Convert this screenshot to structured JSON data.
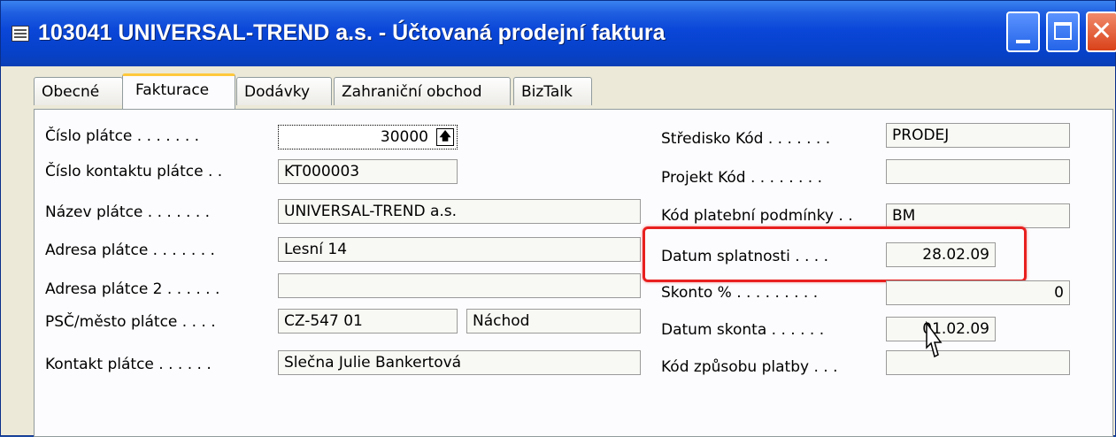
{
  "window": {
    "title": "103041 UNIVERSAL-TREND a.s. - Účtovaná prodejní faktura",
    "minimize_icon": "minimize-icon",
    "maximize_icon": "maximize-icon",
    "close_icon": "close-icon"
  },
  "tabs": [
    {
      "label": "Obecné",
      "active": false
    },
    {
      "label": "Fakturace",
      "active": true
    },
    {
      "label": "Dodávky",
      "active": false
    },
    {
      "label": "Zahraniční obchod",
      "active": false
    },
    {
      "label": "BizTalk",
      "active": false
    }
  ],
  "left_fields": {
    "cislo_platce": {
      "label": "Číslo plátce . . . . . . .",
      "value": "30000",
      "lookup_icon": "arrow-up-icon"
    },
    "cislo_kontaktu": {
      "label": "Číslo kontaktu plátce . .",
      "value": "KT000003"
    },
    "nazev": {
      "label": "Název plátce . . . . . . .",
      "value": "UNIVERSAL-TREND a.s."
    },
    "adresa": {
      "label": "Adresa plátce . . . . . . .",
      "value": "Lesní 14"
    },
    "adresa2": {
      "label": "Adresa plátce 2 . . . . . .",
      "value": ""
    },
    "psc_mesto": {
      "label": "PSČ/město plátce . . . .",
      "psc": "CZ-547 01",
      "mesto": "Náchod"
    },
    "kontakt": {
      "label": "Kontakt plátce . . . . . .",
      "value": "Slečna Julie Bankertová"
    }
  },
  "right_fields": {
    "stredisko": {
      "label": "Středisko Kód . . . . . . .",
      "value": "PRODEJ"
    },
    "projekt": {
      "label": "Projekt Kód . . . . . . . .",
      "value": ""
    },
    "platebni_podminky": {
      "label": "Kód platební podmínky . .",
      "value": "BM"
    },
    "datum_splatnosti": {
      "label": "Datum splatnosti . . . .",
      "value": "28.02.09"
    },
    "skonto": {
      "label": "Skonto % . . . . . . . . .",
      "value": "0"
    },
    "datum_skonta": {
      "label": "Datum skonta . . . . . .",
      "value": "01.02.09"
    },
    "zpusob_platby": {
      "label": "Kód způsobu platby . . .",
      "value": ""
    }
  },
  "colors": {
    "titlebar": "#0a46d8",
    "highlight": "#e8201f",
    "active_tab_accent": "#ffc83c"
  }
}
